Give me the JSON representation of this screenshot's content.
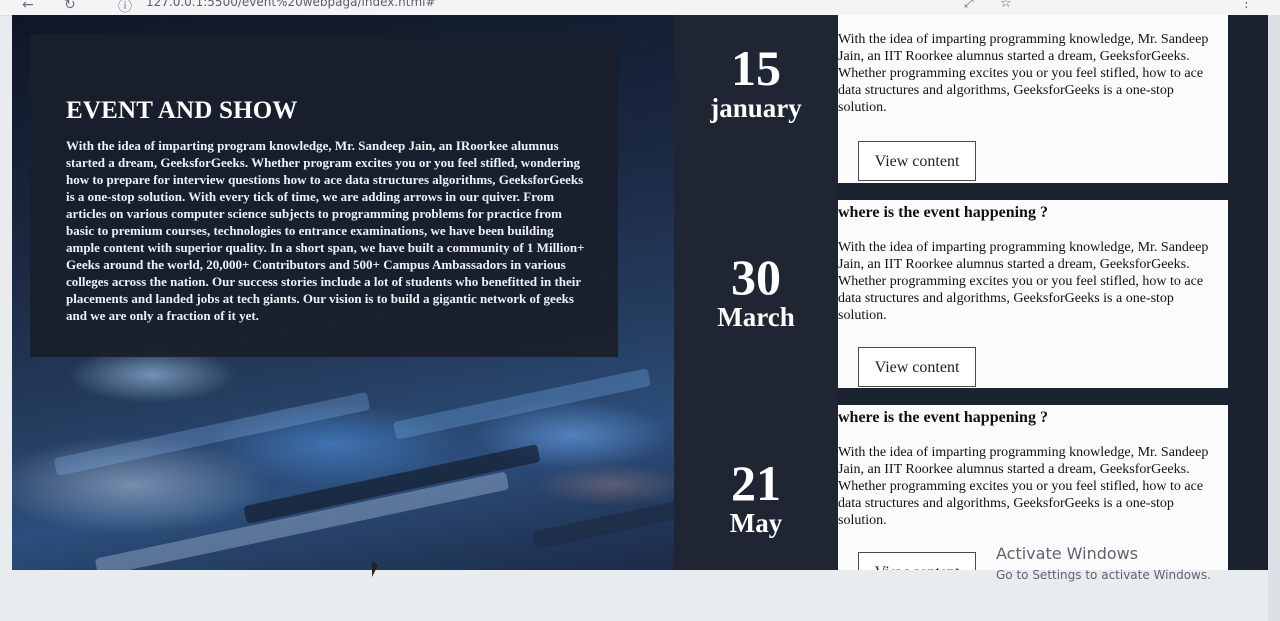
{
  "browser": {
    "url": "127.0.0.1:5500/event%20webpaga/index.html#",
    "back_icon": "←",
    "reload_icon": "↻",
    "info_icon": "ⓘ"
  },
  "hero": {
    "title": "EVENT AND SHOW",
    "body": "With the idea of imparting program knowledge, Mr. Sandeep Jain, an IRoorkee alumnus started a dream, GeeksforGeeks. Whether program excites you or you feel stifled, wondering how to prepare for interview questions how to ace data structures algorithms, GeeksforGeeks is a one-stop solution. With every tick of time, we are adding arrows in our quiver. From articles on various computer science subjects to programming problems for practice from basic to premium courses, technologies to entrance examinations, we have been building ample content with superior quality. In a short span, we have built a community of 1 Million+ Geeks around the world, 20,000+ Contributors and 500+ Campus Ambassadors in various colleges across the nation. Our success stories include a lot of students who benefitted in their placements and landed jobs at tech giants. Our vision is to build a gigantic network of geeks and we are only a fraction of it yet."
  },
  "events": [
    {
      "day": "15",
      "month": "january",
      "question": "",
      "description": "With the idea of imparting programming knowledge, Mr. Sandeep Jain, an IIT Roorkee alumnus started a dream, GeeksforGeeks. Whether programming excites you or you feel stifled, how to ace data structures and algorithms, GeeksforGeeks is a one-stop solution.",
      "button": "View content"
    },
    {
      "day": "30",
      "month": "March",
      "question": "where is the event happening ?",
      "description": "With the idea of imparting programming knowledge, Mr. Sandeep Jain, an IIT Roorkee alumnus started a dream, GeeksforGeeks. Whether programming excites you or you feel stifled, how to ace data structures and algorithms, GeeksforGeeks is a one-stop solution.",
      "button": "View content"
    },
    {
      "day": "21",
      "month": "May",
      "question": "where is the event happening ?",
      "description": "With the idea of imparting programming knowledge, Mr. Sandeep Jain, an IIT Roorkee alumnus started a dream, GeeksforGeeks. Whether programming excites you or you feel stifled, how to ace data structures and algorithms, GeeksforGeeks is a one-stop solution.",
      "button": "View content"
    }
  ],
  "watermark": {
    "title": "Activate Windows",
    "subtitle": "Go to Settings to activate Windows."
  }
}
